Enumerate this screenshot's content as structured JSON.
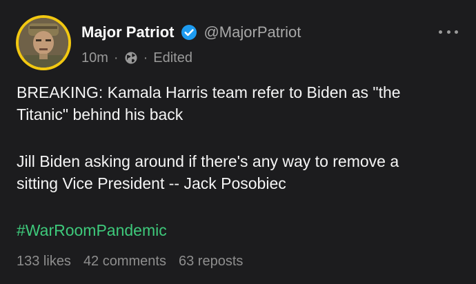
{
  "post": {
    "author": {
      "display_name": "Major Patriot",
      "handle": "@MajorPatriot",
      "verified": true,
      "avatar_ring_color": "#f2c811"
    },
    "meta": {
      "time": "10m",
      "separator": "·",
      "visibility_icon": "globe-icon",
      "edited_label": "Edited"
    },
    "more_icon": "more-horizontal-icon",
    "body": {
      "lines": [
        "BREAKING: Kamala Harris team refer to Biden as \"the",
        "Titanic\" behind his back",
        "Jill Biden asking around if there's any way to remove a",
        "sitting Vice President -- Jack Posobiec"
      ],
      "hashtag": "#WarRoomPandemic"
    },
    "stats": {
      "likes": "133 likes",
      "comments": "42 comments",
      "reposts": "63 reposts"
    }
  },
  "colors": {
    "background": "#1c1c1e",
    "hashtag": "#3ec97b",
    "verified_badge": "#1d9bf0",
    "muted_text": "#8e8e8e"
  }
}
